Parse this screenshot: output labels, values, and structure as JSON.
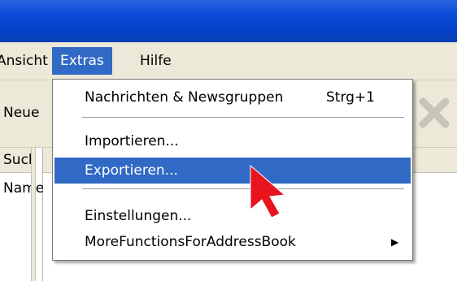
{
  "menubar": {
    "items": [
      {
        "label": "Ansicht"
      },
      {
        "label": "Extras"
      },
      {
        "label": "Hilfe"
      }
    ]
  },
  "toolbar": {
    "new_label": "Neue"
  },
  "left_panel": {
    "header": "Such",
    "text": "Namen"
  },
  "extras_menu": {
    "items": [
      {
        "label": "Nachrichten & Newsgruppen",
        "shortcut": "Strg+1"
      },
      {
        "label": "Importieren..."
      },
      {
        "label": "Exportieren..."
      },
      {
        "label": "Einstellungen..."
      },
      {
        "label": "MoreFunctionsForAddressBook"
      }
    ]
  },
  "colors": {
    "titlebar": "#0a4ad8",
    "menubar": "#ece9d8",
    "highlight": "#316ac5",
    "cursor": "#e8141e"
  },
  "icons": {
    "close": "close-x-icon",
    "submenu": "submenu-arrow-icon",
    "pointer": "mouse-pointer-icon"
  }
}
